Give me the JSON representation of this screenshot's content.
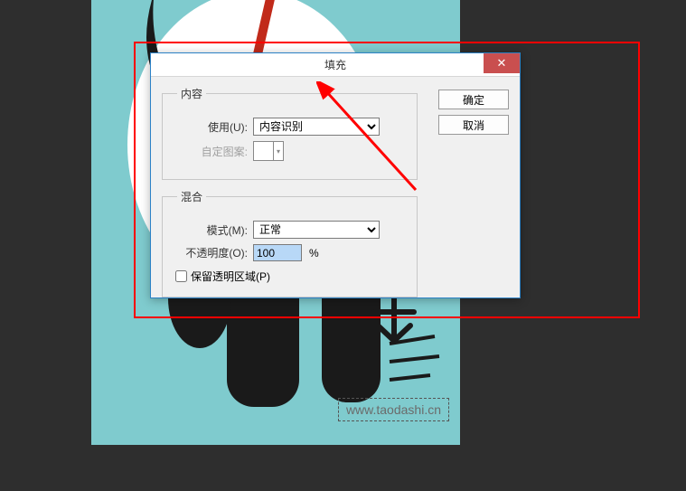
{
  "dialog": {
    "title": "填充",
    "close_glyph": "✕",
    "content_group": "内容",
    "use_label": "使用(U):",
    "use_value": "内容识别",
    "pattern_label": "自定图案:",
    "blend_group": "混合",
    "mode_label": "模式(M):",
    "mode_value": "正常",
    "opacity_label": "不透明度(O):",
    "opacity_value": "100",
    "opacity_unit": "%",
    "preserve_label": "保留透明区域(P)",
    "ok_label": "确定",
    "cancel_label": "取消"
  },
  "watermark": "www.taodashi.cn"
}
